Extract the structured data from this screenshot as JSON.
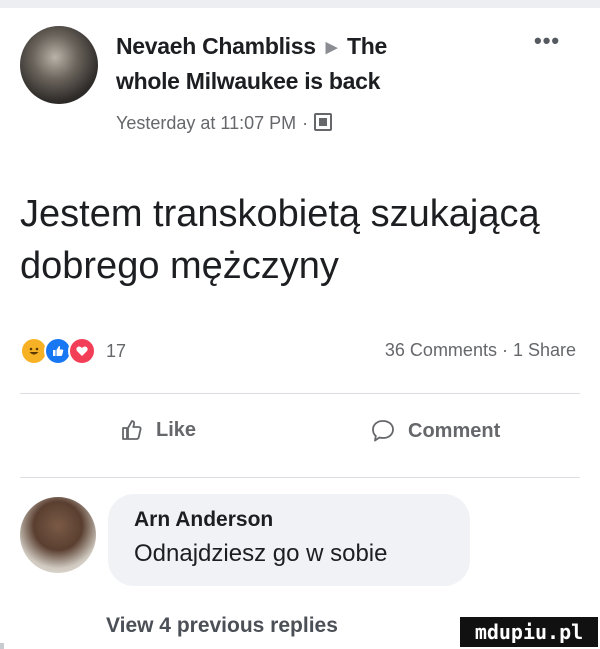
{
  "post": {
    "author": "Nevaeh Chambliss",
    "group_first_word": "The",
    "group_rest": "whole Milwaukee is back",
    "timestamp": "Yesterday at 11:07 PM",
    "separator": "·",
    "more_icon": "more-dots-icon",
    "audience_icon": "group-audience-icon",
    "text": "Jestem transkobietą szukającą dobrego mężczyny"
  },
  "stats": {
    "reaction_icons": [
      "haha",
      "like",
      "love"
    ],
    "reaction_count": "17",
    "comments_shares": "36 Comments · 1 Share"
  },
  "actions": {
    "like_label": "Like",
    "comment_label": "Comment"
  },
  "comment": {
    "author": "Arn Anderson",
    "text": "Odnajdziesz go w sobie"
  },
  "view_replies": "View 4 previous replies",
  "watermark": "mdupiu.pl",
  "colors": {
    "text_primary": "#1c1e21",
    "text_secondary": "#65676b",
    "bubble": "#f0f2f5",
    "like_blue": "#1877f2",
    "love_red": "#f33e58",
    "haha_yellow": "#f7b125"
  }
}
